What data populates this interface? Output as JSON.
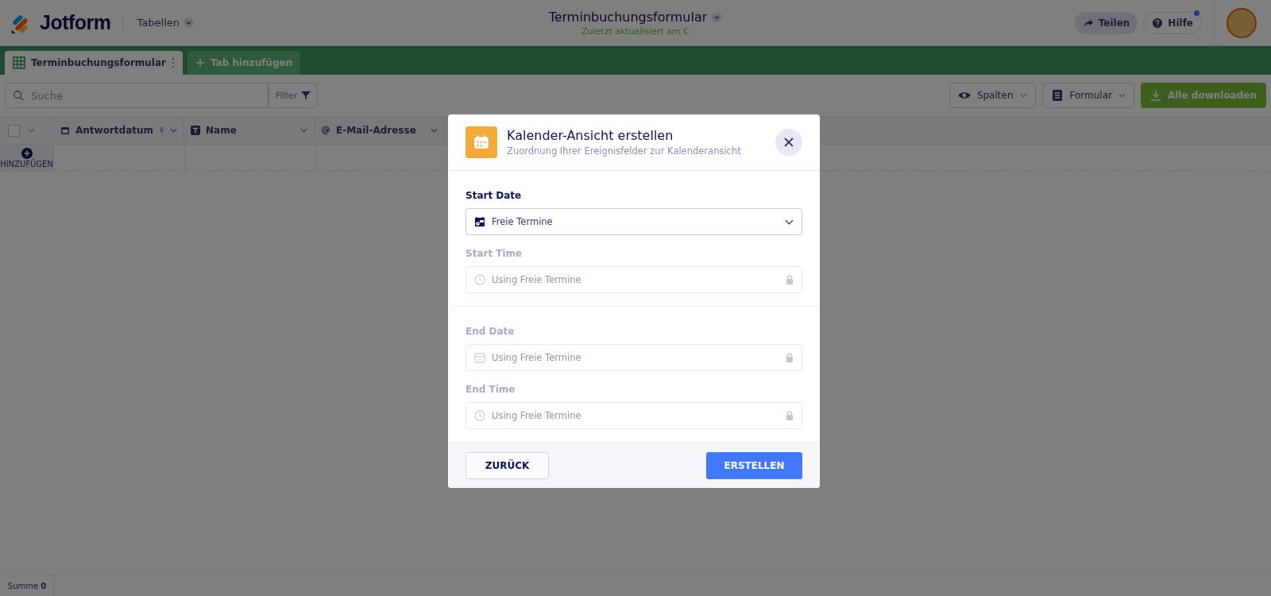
{
  "header": {
    "logo": "Jotform",
    "section": "Tabellen",
    "title": "Terminbuchungsformular",
    "subtitle": "Zuletzt aktualisiert am C",
    "share": "Teilen",
    "help": "Hilfe",
    "help_notification": true
  },
  "tabs": [
    {
      "label": "Terminbuchungsformular",
      "selected": true
    },
    {
      "label": "Tab hinzufügen",
      "selected": false
    }
  ],
  "toolbar": {
    "search_placeholder": "Suche",
    "filter": "Filter",
    "columns": "Spalten",
    "form": "Formular",
    "download": "Alle downloaden"
  },
  "table": {
    "columns": [
      {
        "label": "Antwortdatum",
        "kind": "date",
        "pinned": true
      },
      {
        "label": "Name",
        "kind": "text",
        "pinned": false
      },
      {
        "label": "E-Mail-Adresse",
        "kind": "email",
        "pinned": false
      }
    ],
    "add_label": "HINZUFÜGEN",
    "select_all_checked": false
  },
  "status_bar": {
    "label": "Summe",
    "value": "0"
  },
  "modal": {
    "title": "Kalender-Ansicht erstellen",
    "subtitle": "Zuordnung Ihrer Ereignisfelder zur Kalenderansicht",
    "groups": [
      [
        {
          "label": "Start Date",
          "kind": "date",
          "value": "Freie Termine",
          "locked": false
        },
        {
          "label": "Start Time",
          "kind": "time",
          "value": "Using Freie Termine",
          "locked": true
        }
      ],
      [
        {
          "label": "End Date",
          "kind": "date",
          "value": "Using Freie Termine",
          "locked": true
        },
        {
          "label": "End Time",
          "kind": "time",
          "value": "Using Freie Termine",
          "locked": true
        }
      ]
    ],
    "back": "ZURÜCK",
    "create": "ERSTELLEN"
  }
}
